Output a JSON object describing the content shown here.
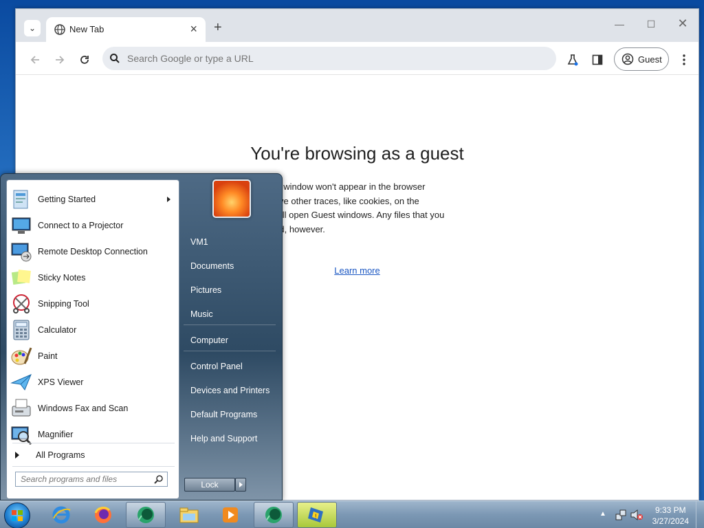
{
  "browser": {
    "tab_title": "New Tab",
    "omnibox_placeholder": "Search Google or type a URL",
    "profile_label": "Guest",
    "guest_heading": "You're browsing as a guest",
    "guest_body_lines": [
      "view in this window won't appear in the browser",
      "y won't leave other traces, like cookies, on the",
      "you close all open Guest windows. Any files that you",
      "e preserved, however."
    ],
    "learn_more": "Learn more"
  },
  "start_menu": {
    "programs": [
      {
        "label": "Getting Started",
        "icon": "getting-started-icon",
        "submenu": true
      },
      {
        "label": "Connect to a Projector",
        "icon": "projector-icon"
      },
      {
        "label": "Remote Desktop Connection",
        "icon": "remote-desktop-icon"
      },
      {
        "label": "Sticky Notes",
        "icon": "sticky-notes-icon"
      },
      {
        "label": "Snipping Tool",
        "icon": "snipping-tool-icon"
      },
      {
        "label": "Calculator",
        "icon": "calculator-icon"
      },
      {
        "label": "Paint",
        "icon": "paint-icon"
      },
      {
        "label": "XPS Viewer",
        "icon": "xps-viewer-icon"
      },
      {
        "label": "Windows Fax and Scan",
        "icon": "fax-scan-icon"
      },
      {
        "label": "Magnifier",
        "icon": "magnifier-icon"
      }
    ],
    "all_programs": "All Programs",
    "search_placeholder": "Search programs and files",
    "right_items": [
      {
        "label": "VM1"
      },
      {
        "label": "Documents"
      },
      {
        "label": "Pictures"
      },
      {
        "label": "Music"
      },
      {
        "label": "Computer"
      },
      {
        "label": "Control Panel"
      },
      {
        "label": "Devices and Printers"
      },
      {
        "label": "Default Programs"
      },
      {
        "label": "Help and Support"
      }
    ],
    "lock_label": "Lock"
  },
  "taskbar": {
    "items": [
      "internet-explorer-icon",
      "firefox-icon",
      "app-green-icon",
      "file-explorer-icon",
      "media-player-icon",
      "app-green-icon",
      "action-center-icon"
    ],
    "time": "9:33 PM",
    "date": "3/27/2024"
  }
}
